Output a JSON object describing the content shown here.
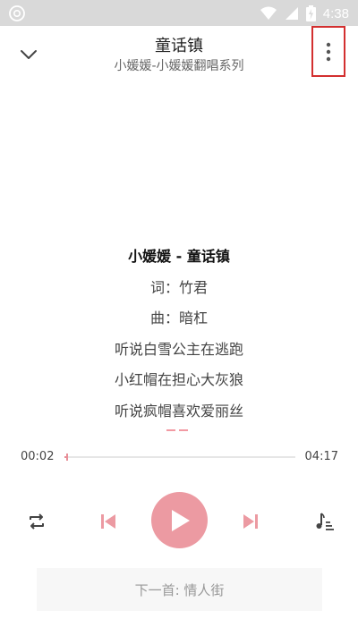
{
  "status_bar": {
    "time": "4:38",
    "icons": [
      "cd-icon",
      "wifi-icon",
      "signal-icon",
      "battery-charging-icon"
    ]
  },
  "header": {
    "title": "童话镇",
    "subtitle": "小媛媛-小媛媛翻唱系列",
    "back_icon": "chevron-down-icon",
    "more_icon": "more-vertical-icon"
  },
  "lyrics": {
    "lines": [
      "小媛媛 - 童话镇",
      "词：竹君",
      "曲：暗杠",
      "听说白雪公主在逃跑",
      "小红帽在担心大灰狼",
      "听说疯帽喜欢爱丽丝"
    ]
  },
  "player": {
    "current_time": "00:02",
    "total_time": "04:17",
    "progress": 0.008,
    "controls": [
      "repeat-icon",
      "previous-icon",
      "play-icon",
      "next-icon",
      "playlist-icon"
    ]
  },
  "next_song": {
    "label": "下一首: 情人街"
  },
  "colors": {
    "accent": "#ec9aa2",
    "status_bar": "#d9d9d9",
    "highlight_box": "#d32f2f"
  }
}
